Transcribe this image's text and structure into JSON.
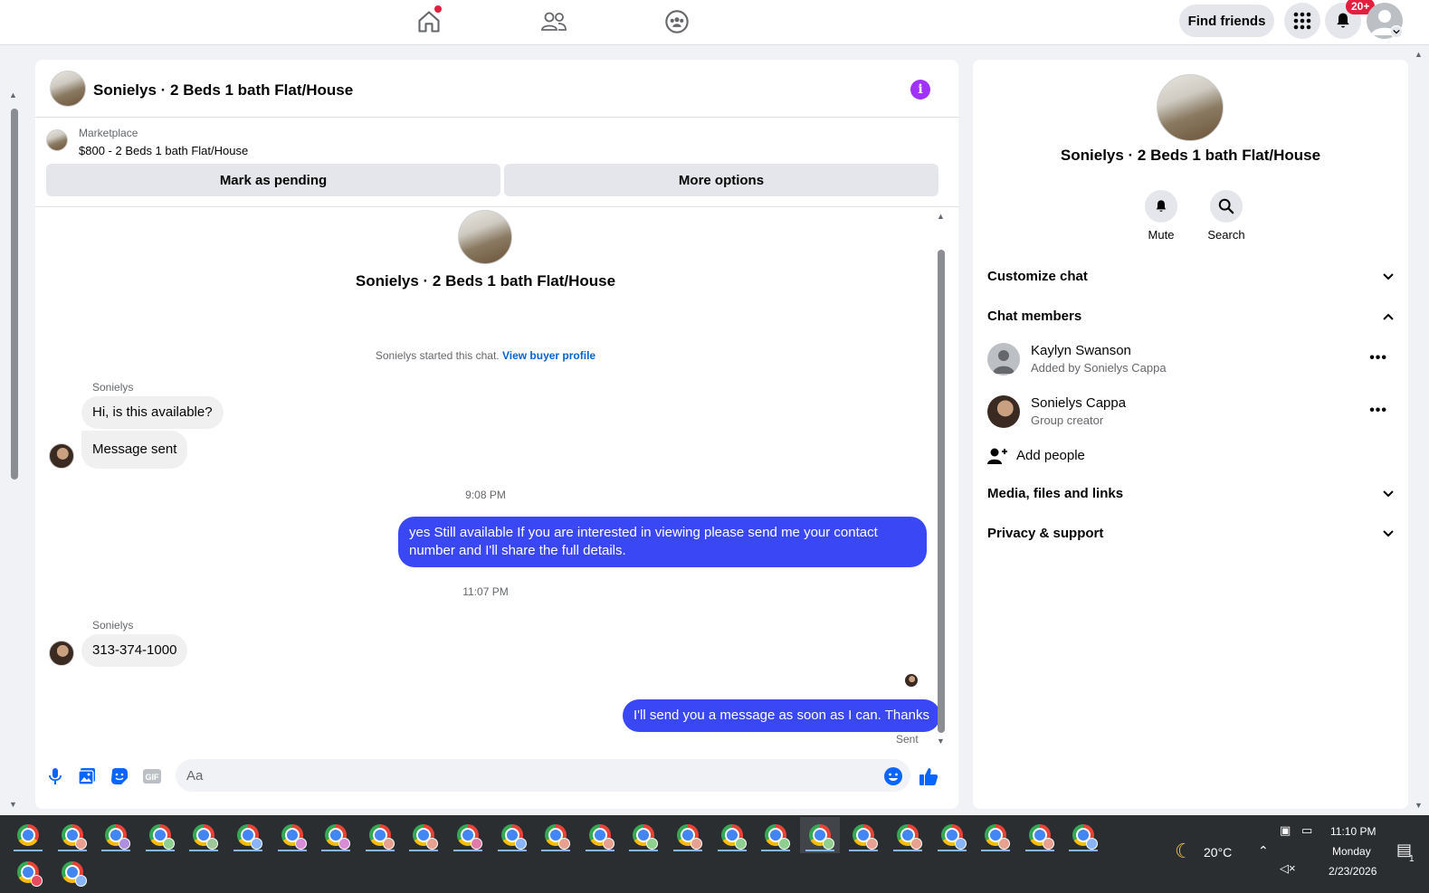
{
  "topbar": {
    "find_friends": "Find friends",
    "notification_badge": "20+"
  },
  "chat": {
    "title": "Sonielys · 2 Beds 1 bath Flat/House",
    "marketplace_label": "Marketplace",
    "listing": "$800 - 2 Beds 1 bath Flat/House",
    "mark_pending": "Mark as pending",
    "more_options": "More options",
    "conversation_title": "Sonielys · 2 Beds 1 bath Flat/House",
    "started_text": "Sonielys started this chat.",
    "view_buyer_profile": "View buyer profile",
    "messages": [
      {
        "sender": "Sonielys",
        "text": "Hi, is this available?"
      },
      {
        "text": "Message sent"
      },
      {
        "time": "9:08 PM"
      },
      {
        "text": "yes Still available If you are interested in viewing please send me your contact number and I'll share the full details."
      },
      {
        "time": "11:07 PM"
      },
      {
        "sender": "Sonielys",
        "text": "313-374-1000"
      },
      {
        "text": "I'll send you a message as soon as I can. Thanks",
        "status": "Sent"
      }
    ],
    "composer_placeholder": "Aa"
  },
  "info_panel": {
    "title": "Sonielys · 2 Beds 1 bath Flat/House",
    "actions": {
      "mute": "Mute",
      "search": "Search"
    },
    "sections": {
      "customize_chat": "Customize chat",
      "chat_members": "Chat members",
      "media": "Media, files and links",
      "privacy": "Privacy & support"
    },
    "members": [
      {
        "name": "Kaylyn Swanson",
        "subtitle": "Added by Sonielys Cappa"
      },
      {
        "name": "Sonielys Cappa",
        "subtitle": "Group creator"
      }
    ],
    "add_people": "Add people"
  },
  "taskbar": {
    "temperature": "20°C",
    "time": "11:10 PM",
    "day": "Monday",
    "date": "2/23/2026",
    "chat_count": "1",
    "profile_colors": [
      "none",
      "#e8a090",
      "#b08ee0",
      "#8fcf8f",
      "#9ec89a",
      "#8ab4f8",
      "#d98ad9",
      "#d98ad9",
      "#e8a090",
      "#e8a090",
      "#e07aa8",
      "#8ab4f8",
      "#e8a090",
      "#e8a090",
      "#8fcf8f",
      "#e8a090",
      "#8fcf8f",
      "#8fcf8f",
      "#8fcf8f",
      "#e8a090",
      "#e8a090",
      "#8ab4f8",
      "#e8a090",
      "#e8a090",
      "#8ab4f8",
      "#e84a5f",
      "#8ab4f8"
    ]
  }
}
